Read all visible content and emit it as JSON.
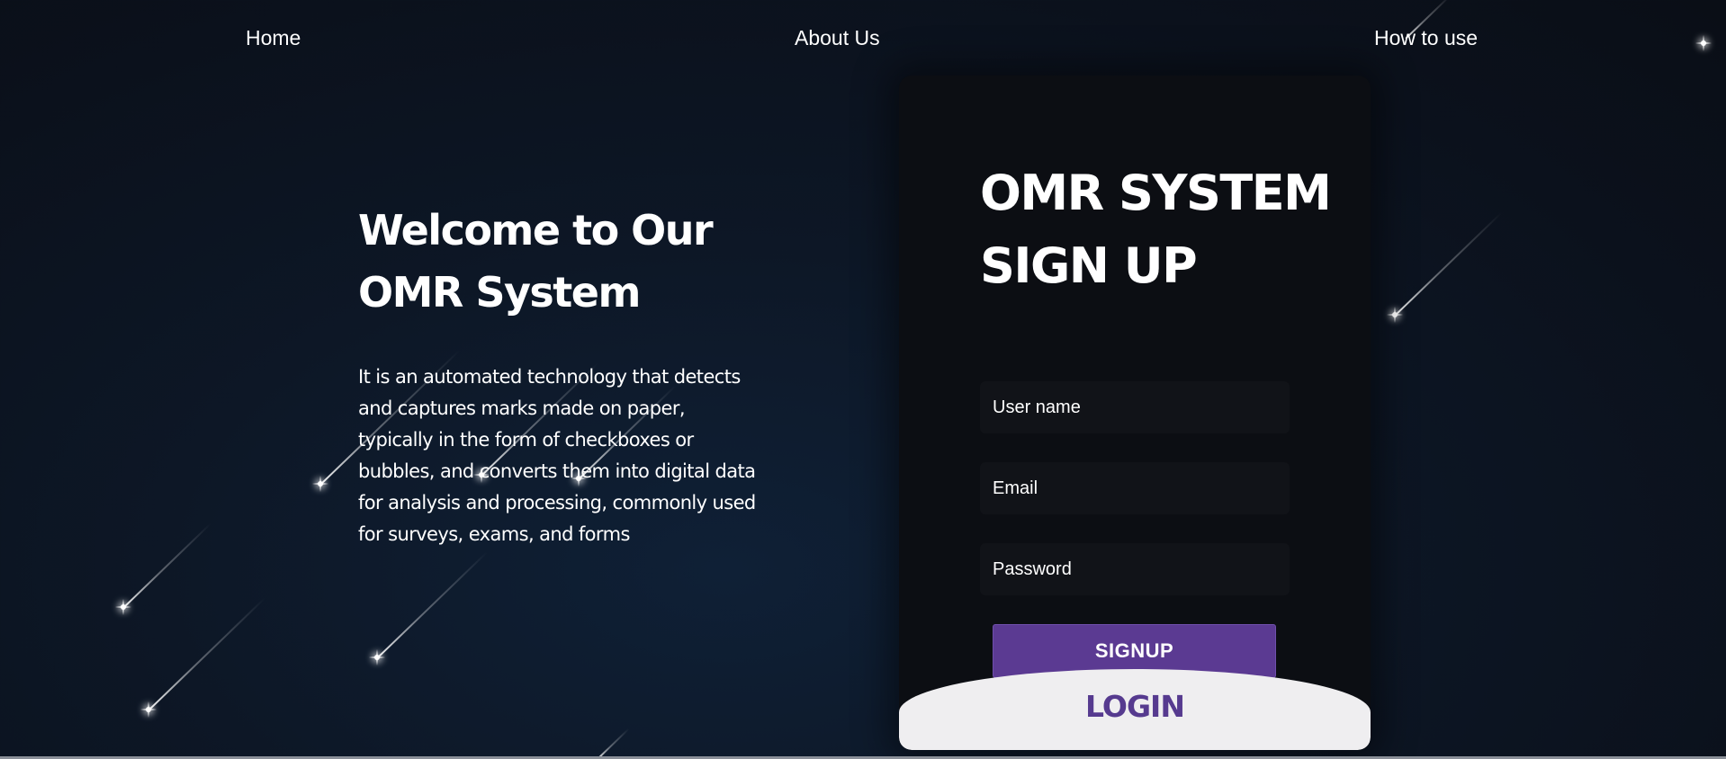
{
  "nav": {
    "home": "Home",
    "about": "About Us",
    "how_to_use": "How to use"
  },
  "welcome": {
    "title_line1": "Welcome to Our",
    "title_line2": "OMR System",
    "description": "It is an automated technology that detects and captures marks made on paper, typically in the form of checkboxes or bubbles, and converts them into digital data for analysis and processing, commonly used for surveys, exams, and forms"
  },
  "signup": {
    "title_line1": "OMR SYSTEM",
    "title_line2": "SIGN UP",
    "username_placeholder": "User name",
    "email_placeholder": "Email",
    "password_placeholder": "Password",
    "signup_label": "SIGNUP",
    "login_label": "LOGIN"
  },
  "colors": {
    "accent": "#5b3a92",
    "login_text": "#563a8f",
    "background": "#0b111c",
    "card": "#0c0e13"
  }
}
